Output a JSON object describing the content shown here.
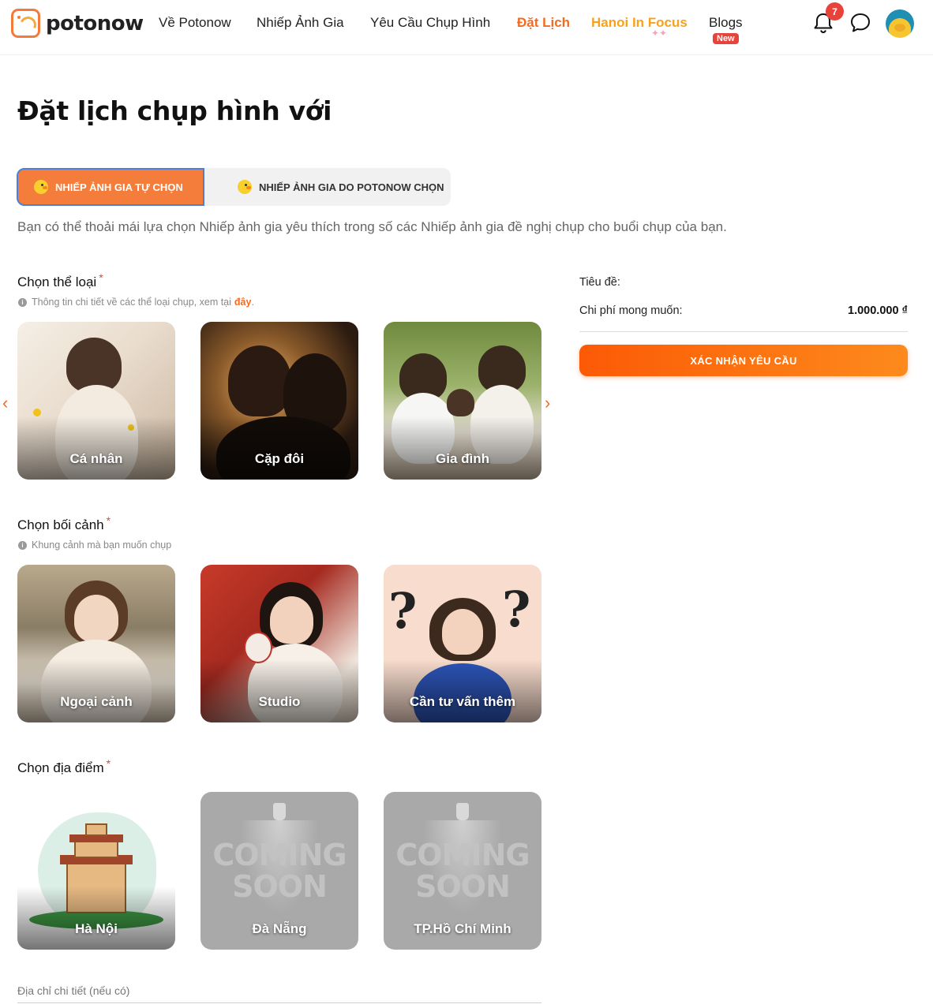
{
  "header": {
    "logo_text": "potonow",
    "nav": [
      {
        "label": "Về Potonow",
        "style": "normal"
      },
      {
        "label": "Nhiếp Ảnh Gia",
        "style": "normal"
      },
      {
        "label": "Yêu Cầu Chụp Hình",
        "style": "normal"
      },
      {
        "label": "Đặt Lịch",
        "style": "accent"
      },
      {
        "label": "Hanoi In Focus",
        "style": "gold"
      },
      {
        "label": "Blogs",
        "style": "normal"
      }
    ],
    "new_badge": "New",
    "notification_count": "7",
    "icons": [
      "bell-icon",
      "chat-icon",
      "avatar"
    ]
  },
  "page": {
    "title": "Đặt lịch chụp hình với",
    "tabs": [
      {
        "label": "Nhiếp ảnh gia tự chọn",
        "active": true
      },
      {
        "label": "Nhiếp ảnh gia do Potonow chọn",
        "active": false
      }
    ],
    "tab_description": "Bạn có thể thoải mái lựa chọn Nhiếp ảnh gia yêu thích trong số các Nhiếp ảnh gia đề nghị chụp cho buổi chụp của bạn."
  },
  "sections": {
    "category": {
      "title": "Chọn thể loại",
      "required_mark": "*",
      "hint": "Thông tin chi tiết về các thể loại chụp, xem tại",
      "hint_link": "đây",
      "hint_end": ".",
      "cards": [
        "Cá nhân",
        "Cặp đôi",
        "Gia đình"
      ]
    },
    "context": {
      "title": "Chọn bối cảnh",
      "required_mark": "*",
      "hint": "Khung cảnh mà bạn muốn chụp",
      "cards": [
        "Ngoại cảnh",
        "Studio",
        "Cần tư vấn thêm"
      ]
    },
    "location": {
      "title": "Chọn địa điểm",
      "required_mark": "*",
      "cards": [
        "Hà Nội",
        "Đà Nẵng",
        "TP.Hồ Chí Minh"
      ],
      "coming_soon_1": "COMING",
      "coming_soon_2": "SOON"
    },
    "address": {
      "placeholder": "Địa chỉ chi tiết (nếu có)"
    }
  },
  "sidebar": {
    "title_label": "Tiêu đề:",
    "cost_label": "Chi phí mong muốn:",
    "cost_value": "1.000.000 ₫",
    "confirm_button": "Xác nhận yêu cầu"
  },
  "colors": {
    "accent": "#f26b22",
    "gold": "#f7a21b",
    "badge_red": "#e8433a",
    "tab_active_bg": "#f47d3c",
    "button_gradient_start": "#fc5a06",
    "button_gradient_end": "#fd8a1c"
  }
}
